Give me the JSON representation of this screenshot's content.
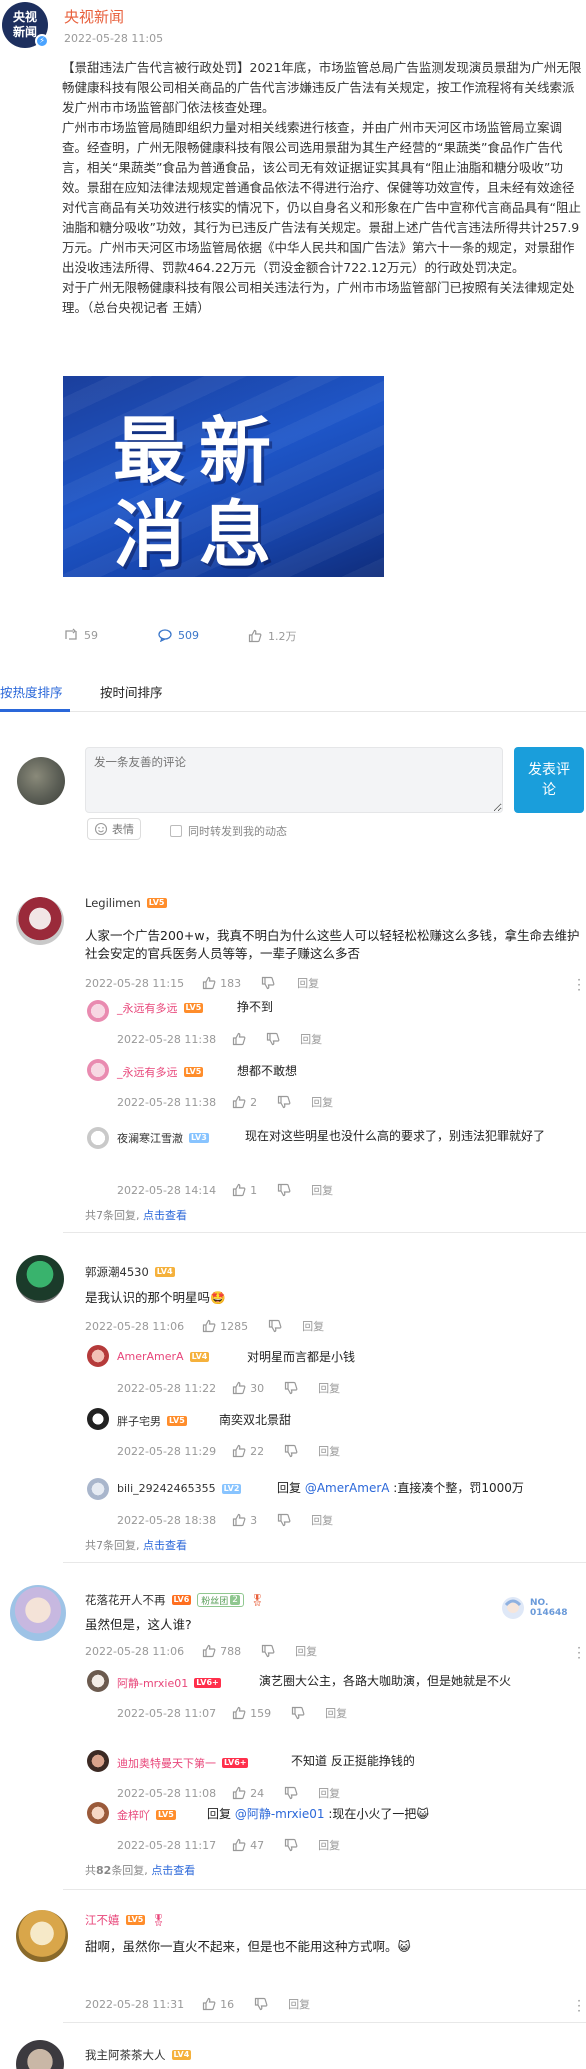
{
  "post": {
    "avatar_text_1": "央视",
    "avatar_text_2": "新闻",
    "author": "央视新闻",
    "time": "2022-05-28 11:05",
    "body": [
      "【景甜违法广告代言被行政处罚】2021年底，市场监管总局广告监测发现演员景甜为广州无限畅健康科技有限公司相关商品的广告代言涉嫌违反广告法有关规定，按工作流程将有关线索派发广州市市场监管部门依法核查处理。",
      "广州市市场监管局随即组织力量对相关线索进行核查，并由广州市天河区市场监管局立案调查。经查明，广州无限畅健康科技有限公司选用景甜为其生产经营的“果蔬类”食品作广告代言，相关“果蔬类”食品为普通食品，该公司无有效证据证实其具有“阻止油脂和糖分吸收”功效。景甜在应知法律法规规定普通食品依法不得进行治疗、保健等功效宣传，且未经有效途径对代言商品有关功效进行核实的情况下，仍以自身名义和形象在广告中宣称代言商品具有“阻止油脂和糖分吸收”功效，其行为已违反广告法有关规定。景甜上述广告代言违法所得共计257.9万元。广州市天河区市场监管局依据《中华人民共和国广告法》第六十一条的规定，对景甜作出没收违法所得、罚款464.22万元（罚没金额合计722.12万元）的行政处罚决定。",
      "对于广州无限畅健康科技有限公司相关违法行为，广州市市场监管部门已按照有关法律规定处理。（总台央视记者 王婧）"
    ],
    "image_word_1": "最新",
    "image_word_2": "消息",
    "repost_count": "59",
    "comment_count": "509",
    "like_count": "1.2万"
  },
  "tabs": {
    "hot": "按热度排序",
    "time": "按时间排序"
  },
  "composer": {
    "placeholder": "发一条友善的评论",
    "submit": "发表评论",
    "emoji": "表情",
    "repost_label": "同时转发到我的动态"
  },
  "comments": [
    {
      "name": "Legilimen",
      "level": "LV5",
      "text": "人家一个广告200+w，我真不明白为什么这些人可以轻轻松松赚这么多钱，拿生命去维护社会安定的官兵医务人员等等，一辈子赚这么多否",
      "time": "2022-05-28 11:15",
      "likes": "183",
      "reply": "回复",
      "replies": [
        {
          "name": "_永远有多远",
          "level": "LV5",
          "text": "挣不到",
          "time": "2022-05-28 11:38",
          "likes": "",
          "reply": "回复"
        },
        {
          "name": "_永远有多远",
          "level": "LV5",
          "text": "想都不敢想",
          "time": "2022-05-28 11:38",
          "likes": "2",
          "reply": "回复"
        },
        {
          "name": "夜澜寒江雪澈",
          "level": "LV3",
          "text": "现在对这些明星也没什么高的要求了，别违法犯罪就好了",
          "time": "2022-05-28 14:14",
          "likes": "1",
          "reply": "回复"
        }
      ],
      "total": "共7条回复,",
      "view_link": "点击查看"
    },
    {
      "name": "郭源潮4530",
      "level": "LV4",
      "text": "是我认识的那个明星吗🤩",
      "time": "2022-05-28 11:06",
      "likes": "1285",
      "reply": "回复",
      "replies": [
        {
          "name": "AmerAmerA",
          "level": "LV4",
          "text": "对明星而言都是小钱",
          "time": "2022-05-28 11:22",
          "likes": "30",
          "reply": "回复"
        },
        {
          "name": "胖子宅男",
          "level": "LV5",
          "text": "南奕双北景甜",
          "time": "2022-05-28 11:29",
          "likes": "22",
          "reply": "回复"
        },
        {
          "name": "bili_29242465355",
          "level": "LV2",
          "text_prefix": "回复 ",
          "mention": "@AmerAmerA",
          "text": " :直接凑个整，罚1000万",
          "time": "2022-05-28 18:38",
          "likes": "3",
          "reply": "回复"
        }
      ],
      "total": "共7条回复,",
      "view_link": "点击查看"
    },
    {
      "name": "花落花开人不再",
      "level": "LV6",
      "fan_badge": "粉丝团",
      "fan_level": "2",
      "card_no": "NO.",
      "card_num": "014648",
      "text": "虽然但是，这人谁?",
      "time": "2022-05-28 11:06",
      "likes": "788",
      "reply": "回复",
      "replies": [
        {
          "name": "阿静-mrxie01",
          "level": "LV6+",
          "text": "演艺圈大公主，各路大咖助演，但是她就是不火",
          "time": "2022-05-28 11:07",
          "likes": "159",
          "reply": "回复"
        },
        {
          "name": "迪加奥特曼天下第一",
          "level": "LV6+",
          "text": "不知道 反正挺能挣钱的",
          "time": "2022-05-28 11:08",
          "likes": "24",
          "reply": "回复"
        },
        {
          "name": "金梓吖",
          "level": "LV5",
          "text_prefix": "回复 ",
          "mention": "@阿静-mrxie01",
          "text": " :现在小火了一把😺",
          "time": "2022-05-28 11:17",
          "likes": "47",
          "reply": "回复"
        }
      ],
      "total_prefix": "共",
      "total_num": "82",
      "total_suffix": "条回复,",
      "view_link": "点击查看"
    },
    {
      "name": "江不嬉",
      "level": "LV5",
      "text": "甜啊，虽然你一直火不起来，但是也不能用这种方式啊。😺",
      "time": "2022-05-28 11:31",
      "likes": "16",
      "reply": "回复"
    },
    {
      "name": "我主阿茶茶大人",
      "level": "LV4"
    }
  ],
  "colors": {
    "accent_blue": "#2a67d9",
    "author_orange": "#e8603c",
    "vip_pink": "#e8467a",
    "submit_blue": "#1a9edb"
  }
}
